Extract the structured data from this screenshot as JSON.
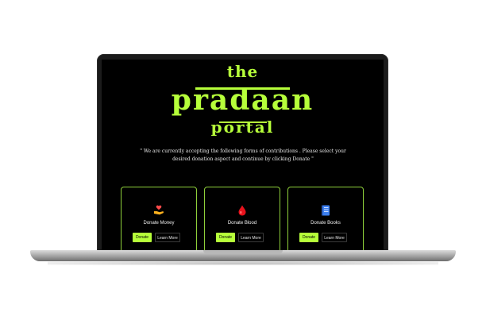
{
  "title": {
    "line1": "the",
    "line2": "pradaan",
    "line3": "portal"
  },
  "intro_text": "\" We are currently accepting the following forms of contributions . Please select your desired donation aspect and continue by clicking Donate \"",
  "cards": [
    {
      "icon": "money-hand-icon",
      "label": "Donate Money",
      "donate": "Donate",
      "learn": "Learn More"
    },
    {
      "icon": "blood-drop-icon",
      "label": "Donate Blood",
      "donate": "Donate",
      "learn": "Learn More"
    },
    {
      "icon": "book-icon",
      "label": "Donate Books",
      "donate": "Donate",
      "learn": "Learn More"
    }
  ],
  "colors": {
    "accent": "#b6ff3a",
    "background": "#000000",
    "text": "#f2f2f2"
  }
}
